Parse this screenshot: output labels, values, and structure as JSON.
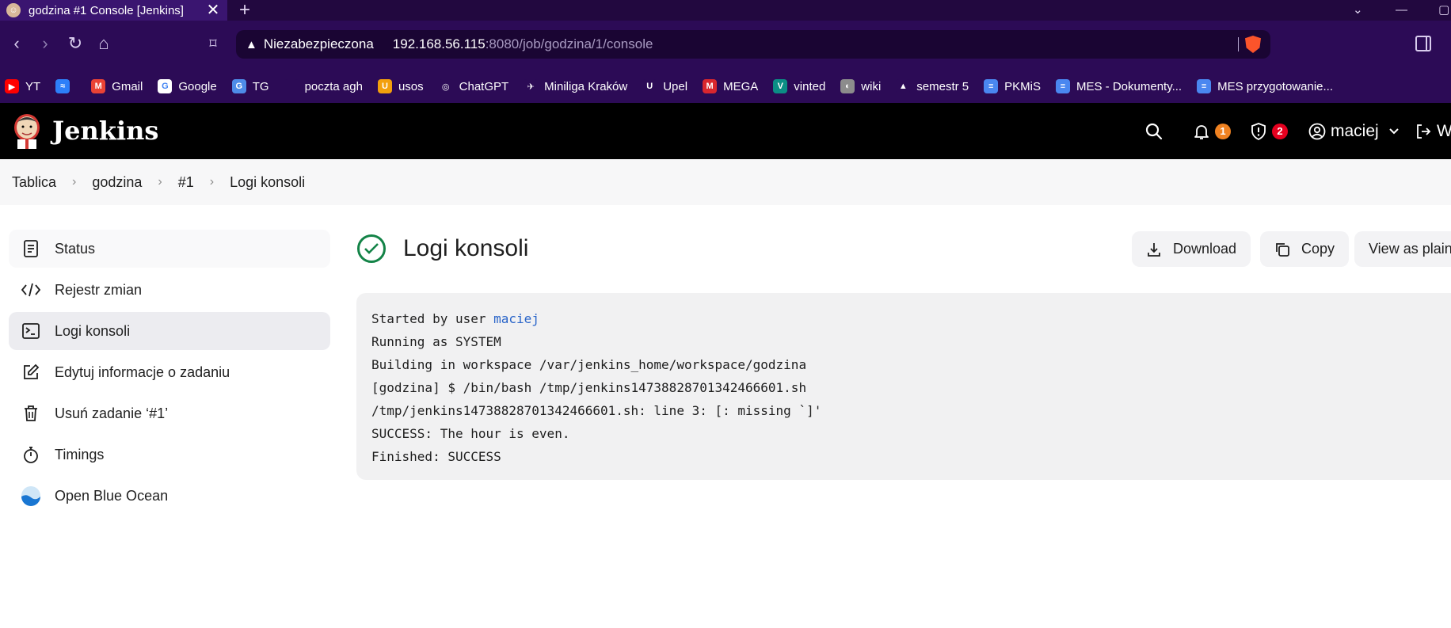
{
  "browser": {
    "tab": {
      "title": "godzina #1 Console [Jenkins]",
      "close": "✕"
    },
    "new_tab": "+",
    "window": {
      "tabs_menu": "⌄",
      "minimize": "—",
      "maximize": "▢"
    },
    "url": {
      "security": "Niezabezpieczona",
      "host": "192.168.56.115",
      "path": ":8080/job/godzina/1/console"
    },
    "bookmarks": [
      {
        "label": "YT",
        "color": "#ff0000",
        "glyph": "▶"
      },
      {
        "label": "",
        "color": "#2d7ff9",
        "glyph": "≈"
      },
      {
        "label": "Gmail",
        "color": "#ea4335",
        "glyph": "M"
      },
      {
        "label": "Google",
        "color": "#ffffff",
        "glyph": "G"
      },
      {
        "label": "TG",
        "color": "#4e8ce8",
        "glyph": "G"
      },
      {
        "label": "poczta agh",
        "color": "#2c0b56",
        "glyph": ""
      },
      {
        "label": "usos",
        "color": "#f3a00c",
        "glyph": "U"
      },
      {
        "label": "ChatGPT",
        "color": "#2c0b56",
        "glyph": "◎"
      },
      {
        "label": "Miniliga Kraków",
        "color": "#2c0b56",
        "glyph": "✈"
      },
      {
        "label": "Upel",
        "color": "#2c0b56",
        "glyph": "U"
      },
      {
        "label": "MEGA",
        "color": "#d9272e",
        "glyph": "M"
      },
      {
        "label": "vinted",
        "color": "#0b8e85",
        "glyph": "V"
      },
      {
        "label": "wiki",
        "color": "#8c8c8c",
        "glyph": "◐"
      },
      {
        "label": "semestr 5",
        "color": "#2c0b56",
        "glyph": "▲"
      },
      {
        "label": "PKMiS",
        "color": "#4a87f0",
        "glyph": "≡"
      },
      {
        "label": "MES - Dokumenty...",
        "color": "#4a87f0",
        "glyph": "≡"
      },
      {
        "label": "MES przygotowanie...",
        "color": "#4a87f0",
        "glyph": "≡"
      }
    ]
  },
  "jenkins": {
    "brand": "Jenkins",
    "notifications_count": "1",
    "security_count": "2",
    "user": "maciej",
    "logout_label": "W",
    "colors": {
      "notify": "#f08221",
      "security": "#e6001f",
      "success": "#138347",
      "link": "#2a65c9"
    }
  },
  "breadcrumb": [
    {
      "label": "Tablica"
    },
    {
      "label": "godzina"
    },
    {
      "label": "#1"
    },
    {
      "label": "Logi konsoli"
    }
  ],
  "sidebar": {
    "items": [
      {
        "label": "Status",
        "icon": "document-icon"
      },
      {
        "label": "Rejestr zmian",
        "icon": "code-icon"
      },
      {
        "label": "Logi konsoli",
        "icon": "terminal-icon",
        "active": true
      },
      {
        "label": "Edytuj informacje o zadaniu",
        "icon": "edit-icon"
      },
      {
        "label": "Usuń zadanie ‘#1’",
        "icon": "trash-icon"
      },
      {
        "label": "Timings",
        "icon": "stopwatch-icon"
      },
      {
        "label": "Open Blue Ocean",
        "icon": "blue-ocean-icon"
      }
    ]
  },
  "main": {
    "title": "Logi konsoli",
    "actions": {
      "download": "Download",
      "copy": "Copy",
      "view_plain": "View as plain"
    },
    "console": {
      "started_prefix": "Started by user ",
      "started_user": "maciej",
      "lines": [
        "Running as SYSTEM",
        "Building in workspace /var/jenkins_home/workspace/godzina",
        "[godzina] $ /bin/bash /tmp/jenkins14738828701342466601.sh",
        "/tmp/jenkins14738828701342466601.sh: line 3: [: missing `]'",
        "SUCCESS: The hour is even.",
        "Finished: SUCCESS"
      ]
    }
  }
}
